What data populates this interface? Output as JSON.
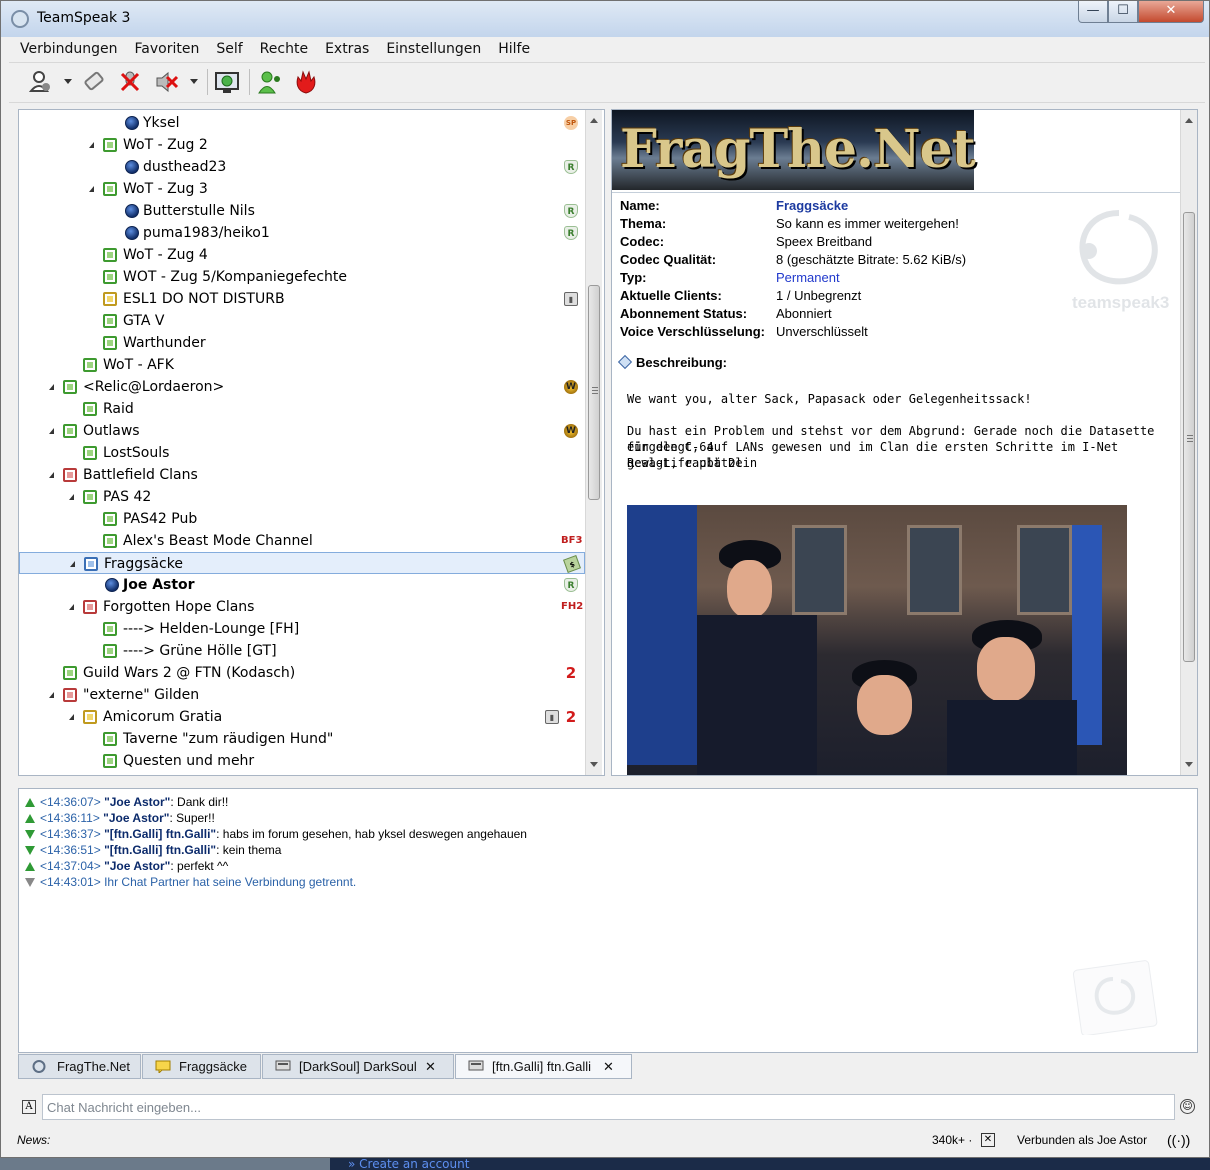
{
  "window": {
    "title": "TeamSpeak 3",
    "controls": {
      "minimize": "—",
      "maximize": "☐",
      "close": "✕"
    }
  },
  "menu": [
    "Verbindungen",
    "Favoriten",
    "Self",
    "Rechte",
    "Extras",
    "Einstellungen",
    "Hilfe"
  ],
  "toolbar": {
    "icons": [
      "connect-icon",
      "disconnect-eraser-icon",
      "mute-microphone-icon",
      "mute-speakers-icon",
      "away-monitor-icon",
      "contacts-icon",
      "activate-microphone-icon"
    ]
  },
  "tree": {
    "rows": [
      {
        "label": "Yksel",
        "kind": "client",
        "badge": "sp"
      },
      {
        "label": "WoT - Zug 2",
        "kind": "channel-green",
        "expanded": true
      },
      {
        "label": "dusthead23",
        "kind": "client",
        "badge": "rank"
      },
      {
        "label": "WoT - Zug 3",
        "kind": "channel-green",
        "expanded": true
      },
      {
        "label": "Butterstulle Nils",
        "kind": "client",
        "badge": "rank"
      },
      {
        "label": "puma1983/heiko1",
        "kind": "client",
        "badge": "rank"
      },
      {
        "label": "WoT - Zug 4",
        "kind": "channel-green"
      },
      {
        "label": "WOT - Zug 5/Kompaniegefechte",
        "kind": "channel-green"
      },
      {
        "label": "ESL1 DO NOT DISTURB",
        "kind": "channel-yellow",
        "badge": "lock"
      },
      {
        "label": "GTA V",
        "kind": "channel-green"
      },
      {
        "label": "Warthunder",
        "kind": "channel-green"
      },
      {
        "label": "WoT - AFK",
        "kind": "channel-green"
      },
      {
        "label": "<Relic@Lordaeron>",
        "kind": "channel-green",
        "expanded": true,
        "badge": "wow"
      },
      {
        "label": "Raid",
        "kind": "channel-green"
      },
      {
        "label": "Outlaws",
        "kind": "channel-green",
        "expanded": true,
        "badge": "wow"
      },
      {
        "label": "LostSouls",
        "kind": "channel-green"
      },
      {
        "label": "Battlefield Clans",
        "kind": "channel-red",
        "expanded": true
      },
      {
        "label": "PAS 42",
        "kind": "channel-green",
        "expanded": true
      },
      {
        "label": "PAS42 Pub",
        "kind": "channel-green"
      },
      {
        "label": "Alex's Beast Mode Channel",
        "kind": "channel-green",
        "badge": "bf3"
      },
      {
        "label": "Fraggsäcke",
        "kind": "channel-blue",
        "expanded": true,
        "badge": "money",
        "selected": true
      },
      {
        "label": "Joe Astor",
        "kind": "client",
        "badge": "rank",
        "bold": true
      },
      {
        "label": "Forgotten Hope Clans",
        "kind": "channel-red",
        "expanded": true,
        "badge": "fh2"
      },
      {
        "label": "----> Helden-Lounge [FH]",
        "kind": "channel-green"
      },
      {
        "label": "----> Grüne Hölle [GT]",
        "kind": "channel-green"
      },
      {
        "label": "Guild Wars 2 @ FTN  (Kodasch)",
        "kind": "channel-green",
        "badge": "two"
      },
      {
        "label": "\"externe\" Gilden",
        "kind": "channel-red",
        "expanded": true
      },
      {
        "label": "Amicorum Gratia",
        "kind": "channel-yellow",
        "expanded": true,
        "badge": "lock-two"
      },
      {
        "label": "Taverne \"zum räudigen Hund\"",
        "kind": "channel-green"
      },
      {
        "label": "Questen und mehr",
        "kind": "channel-green"
      }
    ],
    "badge_text": {
      "sp": "SP",
      "rank": "R",
      "lock": "▮",
      "wow": "W",
      "bf3": "3",
      "money": "$",
      "fh2": "2",
      "two": "2",
      "bf_prefix": "BF",
      "fh_prefix": "FH"
    }
  },
  "banner": {
    "text": "FragThe.Net"
  },
  "info": {
    "fields": [
      {
        "key": "Name:",
        "value": "Fraggsäcke",
        "style": "blue"
      },
      {
        "key": "Thema:",
        "value": "So kann es immer weitergehen!"
      },
      {
        "key": "Codec:",
        "value": "Speex Breitband"
      },
      {
        "key": "Codec Qualität:",
        "value": "8 (geschätzte Bitrate: 5.62 KiB/s)"
      },
      {
        "key": "Typ:",
        "value": "Permanent",
        "style": "link"
      },
      {
        "key": "Aktuelle Clients:",
        "value": "1 / Unbegrenzt"
      },
      {
        "key": "Abonnement Status:",
        "value": "Abonniert"
      },
      {
        "key": "Voice Verschlüsselung:",
        "value": "Unverschlüsselt"
      }
    ],
    "description_heading": "Beschreibung:",
    "description": [
      "We want you, alter Sack, Papasack oder Gelegenheitssack!",
      "Du hast ein Problem und stehst vor dem Abgrund: Gerade noch die Datasette für den C-64",
      "eingelegt, auf LANs gewesen und im Clan die ersten Schritte im I-Net gewagt, raubt Dein",
      "Real-Life plätzl"
    ],
    "watermark": "teamspeak3"
  },
  "chat": {
    "lines": [
      {
        "dir": "up",
        "time": "<14:36:07>",
        "name": "\"Joe Astor\"",
        "text": ": Dank dir!!"
      },
      {
        "dir": "up",
        "time": "<14:36:11>",
        "name": "\"Joe Astor\"",
        "text": ": Super!!"
      },
      {
        "dir": "dn",
        "time": "<14:36:37>",
        "name": "\"[ftn.Galli] ftn.Galli\"",
        "text": ": habs im forum gesehen, hab yksel deswegen angehauen"
      },
      {
        "dir": "dn",
        "time": "<14:36:51>",
        "name": "\"[ftn.Galli] ftn.Galli\"",
        "text": ": kein thema"
      },
      {
        "dir": "up",
        "time": "<14:37:04>",
        "name": "\"Joe Astor\"",
        "text": ": perfekt ^^"
      },
      {
        "dir": "gr",
        "time": "<14:43:01>",
        "name": "",
        "text": " Ihr Chat Partner hat seine Verbindung getrennt."
      }
    ]
  },
  "tabs": [
    {
      "label": "FragThe.Net",
      "style": "blue",
      "icon": "server-icon"
    },
    {
      "label": "Fraggsäcke",
      "style": "blue",
      "icon": "channel-chat-icon"
    },
    {
      "label": "[DarkSoul] DarkSoul",
      "style": "grey",
      "icon": "private-chat-icon",
      "close": "✕"
    },
    {
      "label": "[ftn.Galli] ftn.Galli",
      "style": "grey",
      "icon": "private-chat-icon",
      "close": "✕",
      "active": true
    }
  ],
  "input": {
    "placeholder": "Chat Nachricht eingeben...",
    "format_icon": "A",
    "emoticon": "☺"
  },
  "status": {
    "news": "News:",
    "bandwidth": "340k+ ·",
    "bandwidth_close": "✕",
    "connection": "Verbunden als Joe Astor",
    "wifi": "((·))"
  },
  "background": {
    "text": "» Create an account"
  },
  "colors": {
    "accent": "#1c3aa0",
    "link": "#2139cc",
    "timestamp": "#2b62a8",
    "chat_name": "#0b2a6b",
    "green_arrow": "#2f9a35",
    "badge_red": "#d21b1b"
  }
}
